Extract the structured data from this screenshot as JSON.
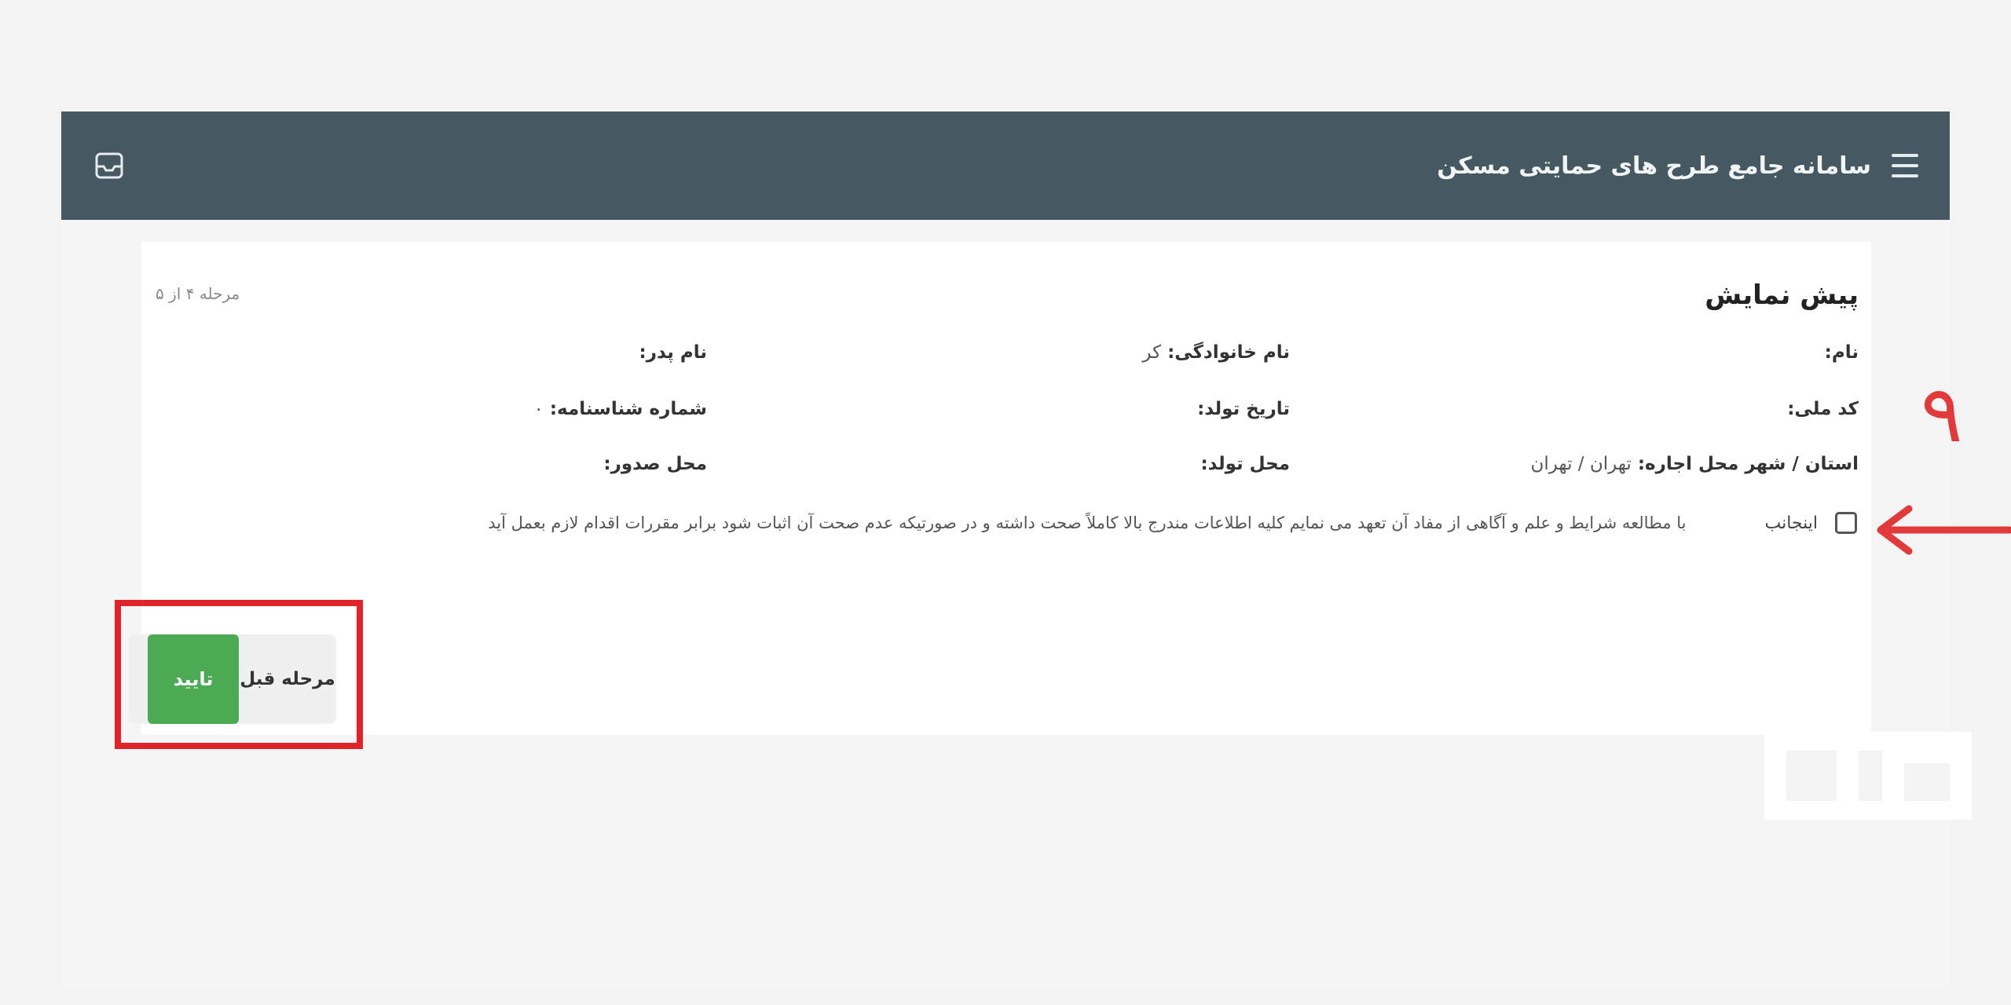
{
  "header": {
    "title": "سامانه جامع طرح های حمایتی مسکن",
    "menu_icon": "hamburger-menu-icon",
    "inbox_icon": "inbox-tray-icon",
    "background_color": "#465963"
  },
  "preview": {
    "title": "پیش نمایش",
    "step_info": "مرحله ۴ از ۵",
    "fields": {
      "name": {
        "label": "نام:",
        "value": ""
      },
      "family_name": {
        "label": "نام خانوادگی:",
        "value": "کر"
      },
      "father_name": {
        "label": "نام پدر:",
        "value": ""
      },
      "national_code": {
        "label": "کد ملی:",
        "value": ""
      },
      "birth_date": {
        "label": "تاریخ تولد:",
        "value": ""
      },
      "id_number": {
        "label": "شماره شناسنامه:",
        "value": "۰"
      },
      "rental_location": {
        "label": "استان / شهر محل اجاره:",
        "value": "تهران / تهران"
      },
      "birth_place": {
        "label": "محل تولد:",
        "value": ""
      },
      "issue_place": {
        "label": "محل صدور:",
        "value": ""
      }
    },
    "agreement": {
      "checked": false,
      "label": "اینجانب",
      "text": "با مطالعه شرایط و علم و آگاهی از مفاد آن تعهد می نمایم کلیه اطلاعات مندرج بالا کاملاً صحت داشته و در صورتیکه عدم صحت آن اثبات شود برابر مقررات اقدام لازم بعمل آید"
    }
  },
  "actions": {
    "previous_label": "مرحله قبل",
    "confirm_label": "تایید",
    "confirm_color": "#4caa55"
  },
  "annotations": {
    "step_number": "۹",
    "color": "#e23a3a"
  }
}
